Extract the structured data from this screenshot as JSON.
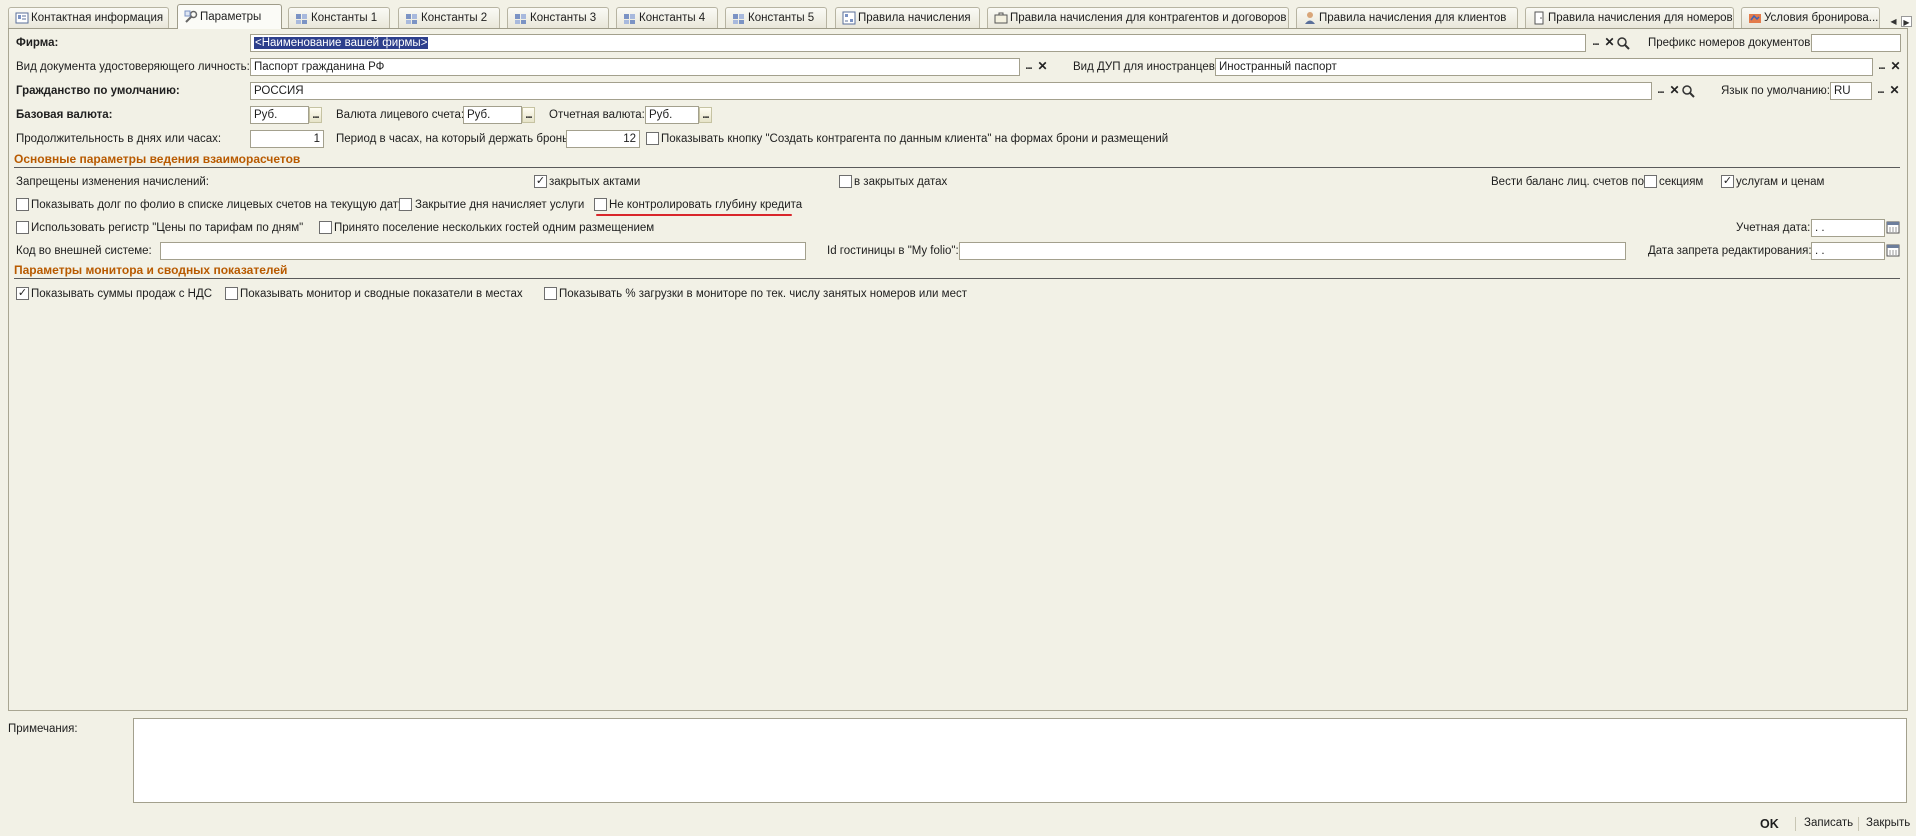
{
  "tabs": [
    {
      "label": "Контактная информация",
      "icon": "contact-card-icon"
    },
    {
      "label": "Параметры",
      "icon": "settings-wrench-icon",
      "active": true
    },
    {
      "label": "Константы 1",
      "icon": "constants-icon"
    },
    {
      "label": "Константы 2",
      "icon": "constants-icon"
    },
    {
      "label": "Константы 3",
      "icon": "constants-icon"
    },
    {
      "label": "Константы 4",
      "icon": "constants-icon"
    },
    {
      "label": "Константы 5",
      "icon": "constants-icon"
    },
    {
      "label": "Правила начисления",
      "icon": "rules-icon"
    },
    {
      "label": "Правила начисления для контрагентов и договоров",
      "icon": "briefcase-icon"
    },
    {
      "label": "Правила начисления для клиентов",
      "icon": "person-icon"
    },
    {
      "label": "Правила начисления для номеров",
      "icon": "door-icon"
    },
    {
      "label": "Условия бронирова...",
      "icon": "booking-conditions-icon"
    }
  ],
  "form": {
    "firm_label": "Фирма:",
    "firm_value": "<Наименование вашей фирмы>",
    "doc_prefix_label": "Префикс номеров документов:",
    "doc_prefix_value": "",
    "id_doc_label": "Вид документа удостоверяющего личность:",
    "id_doc_value": "Паспорт гражданина РФ",
    "foreign_doc_label": "Вид ДУП для иностранцев:",
    "foreign_doc_value": "Иностранный паспорт",
    "citizenship_label": "Гражданство по умолчанию:",
    "citizenship_value": "РОССИЯ",
    "language_label": "Язык по умолчанию:",
    "language_value": "RU",
    "base_currency_label": "Базовая валюта:",
    "base_currency_value": "Руб.",
    "account_currency_label": "Валюта лицевого счета:",
    "account_currency_value": "Руб.",
    "report_currency_label": "Отчетная валюта:",
    "report_currency_value": "Руб.",
    "duration_label": "Продолжительность в днях или часах:",
    "duration_value": "1",
    "hold_period_label": "Период в часах, на который держать бронь:",
    "hold_period_value": "12",
    "show_create_contractor_label": "Показывать кнопку \"Создать контрагента по данным клиента\" на формах брони и размещений"
  },
  "section_settlements": {
    "title": "Основные параметры ведения взаиморасчетов",
    "forbidden_changes_label": "Запрещены изменения начислений:",
    "closed_acts_label": "закрытых актами",
    "closed_dates_label": "в закрытых датах",
    "balance_label": "Вести баланс лиц. счетов по:",
    "sections_label": "секциям",
    "services_prices_label": "услугам и ценам",
    "show_debt_label": "Показывать долг по фолио в списке лицевых счетов на текущую дату",
    "day_close_label": "Закрытие дня начисляет услуги",
    "no_credit_depth_label": "Не контролировать глубину кредита",
    "use_register_label": "Использовать регистр \"Цены по тарифам по дням\"",
    "multi_guest_label": "Принято поселение нескольких гостей одним размещением",
    "account_date_label": "Учетная дата:",
    "account_date_value": " .  .",
    "external_code_label": "Код во внешней системе:",
    "external_code_value": "",
    "myfolio_label": "Id гостиницы в \"My folio\":",
    "myfolio_value": "",
    "edit_ban_date_label": "Дата запрета редактирования:",
    "edit_ban_date_value": " .  ."
  },
  "section_monitor": {
    "title": "Параметры монитора и сводных показателей",
    "show_sales_vat_label": "Показывать суммы продаж с НДС",
    "show_monitor_places_label": "Показывать монитор и сводные показатели в местах",
    "show_load_label": "Показывать % загрузки в мониторе по тек. числу занятых номеров или мест"
  },
  "checkboxes": {
    "closed_acts": true,
    "closed_dates": false,
    "sections": false,
    "services_prices": true,
    "show_create_contractor": false,
    "show_debt": false,
    "day_close": false,
    "no_credit_depth": false,
    "use_register": false,
    "multi_guest": false,
    "show_sales_vat": true,
    "show_monitor_places": false,
    "show_load": false
  },
  "notes": {
    "label": "Примечания:",
    "value": ""
  },
  "bottombar": {
    "ok_label": "OK",
    "save_label": "Записать",
    "close_label": "Закрыть"
  },
  "colors": {
    "section_title": "#b85a00",
    "highlight_underline": "#d9262b",
    "selection": "#2d3f8c"
  }
}
